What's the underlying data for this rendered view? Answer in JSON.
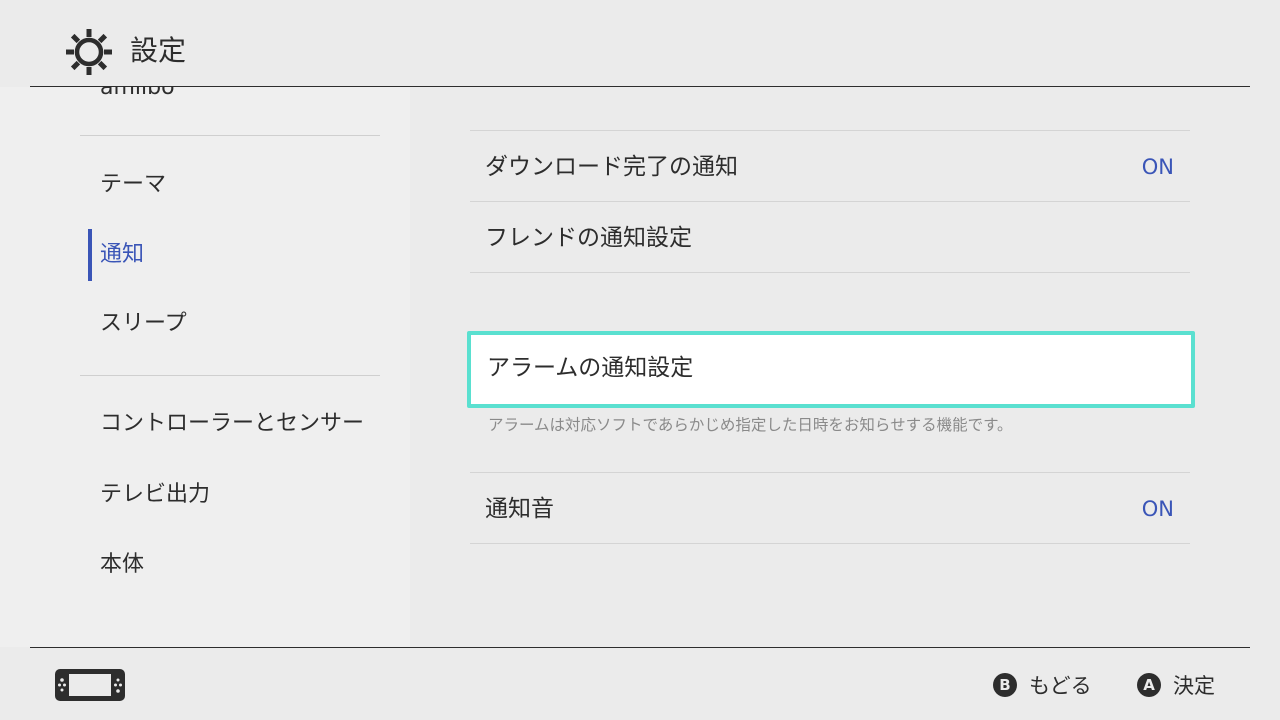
{
  "header": {
    "title": "設定",
    "icon": "gear-icon"
  },
  "sidebar": {
    "items": [
      {
        "label": "amiibo"
      },
      {
        "label": "テーマ"
      },
      {
        "label": "通知"
      },
      {
        "label": "スリープ"
      },
      {
        "label": "コントローラーとセンサー"
      },
      {
        "label": "テレビ出力"
      },
      {
        "label": "本体"
      }
    ],
    "active_index": 2
  },
  "main": {
    "rows": [
      {
        "label": "ダウンロード完了の通知",
        "value": "ON"
      },
      {
        "label": "フレンドの通知設定"
      },
      {
        "label": "アラームの通知設定",
        "description": "アラームは対応ソフトであらかじめ指定した日時をお知らせする機能です。"
      },
      {
        "label": "通知音",
        "value": "ON"
      }
    ],
    "selected_index": 2
  },
  "footer": {
    "back": {
      "button": "B",
      "label": "もどる"
    },
    "confirm": {
      "button": "A",
      "label": "決定"
    },
    "console_icon": "handheld-console-icon"
  },
  "colors": {
    "accent": "#3a55b7",
    "selection": "#5ae0d0",
    "background": "#ebebeb"
  }
}
